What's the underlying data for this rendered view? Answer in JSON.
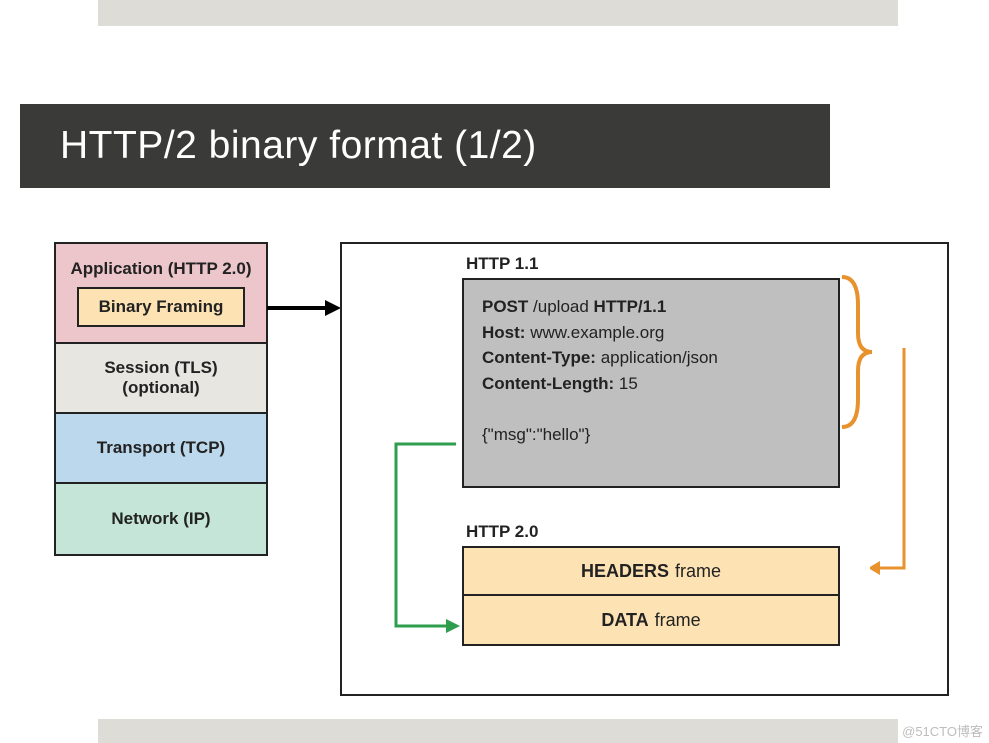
{
  "title": "HTTP/2 binary format (1/2)",
  "stack": {
    "application": "Application (HTTP 2.0)",
    "binary_framing": "Binary Framing",
    "session": "Session (TLS) (optional)",
    "transport": "Transport (TCP)",
    "network": "Network (IP)"
  },
  "right": {
    "http11_label": "HTTP 1.1",
    "request": {
      "method": "POST",
      "path": "/upload",
      "version": "HTTP/1.1",
      "host_label": "Host:",
      "host": "www.example.org",
      "ctype_label": "Content-Type:",
      "ctype": "application/json",
      "clen_label": "Content-Length:",
      "clen": "15",
      "body": "{\"msg\":\"hello\"}"
    },
    "http20_label": "HTTP 2.0",
    "headers_bold": "HEADERS",
    "headers_rest": "frame",
    "data_bold": "DATA",
    "data_rest": "frame"
  },
  "watermark": "@51CTO博客"
}
